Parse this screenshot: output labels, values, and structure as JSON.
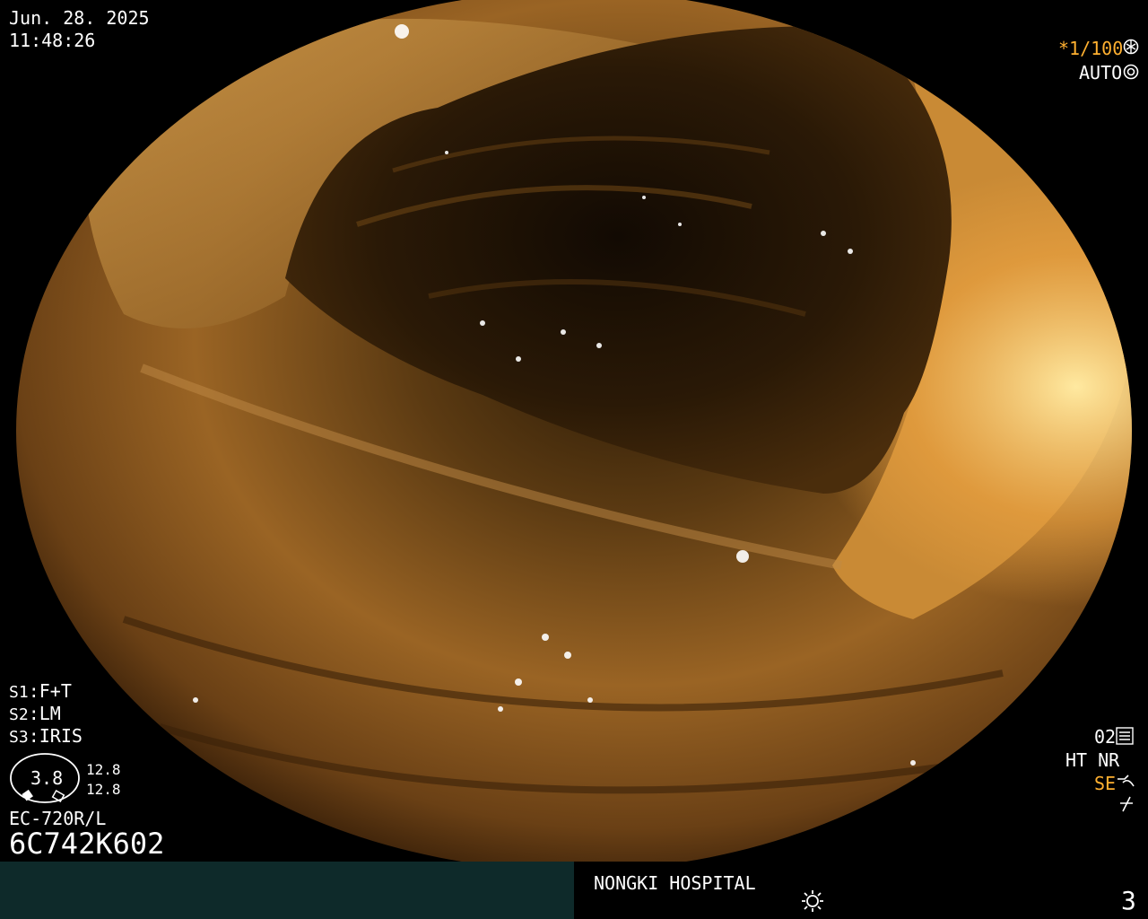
{
  "header": {
    "date": "Jun. 28. 2025",
    "time": "11:48:26"
  },
  "top_right": {
    "shutter": "*1/100",
    "shutter_icon": "shutter-icon",
    "exposure": "AUTO",
    "exposure_icon": "iris-icon"
  },
  "switches": {
    "s1": {
      "key": "S1",
      "value": "F+T"
    },
    "s2": {
      "key": "S2",
      "value": "LM"
    },
    "s3": {
      "key": "S3",
      "value": "IRIS"
    }
  },
  "gauge": {
    "center": "3.8",
    "upper": "12.8",
    "lower": "12.8"
  },
  "scope_model": "EC-720R/L",
  "serial": "6C742K602",
  "bottom_right": {
    "mode": "02",
    "ht_nr": "HT NR",
    "se": "SE",
    "colors": {
      "orange": "#ffb030"
    }
  },
  "footer": {
    "hospital": "NONGKI HOSPITAL",
    "brightness_icon": "sun-icon",
    "page": "3"
  }
}
